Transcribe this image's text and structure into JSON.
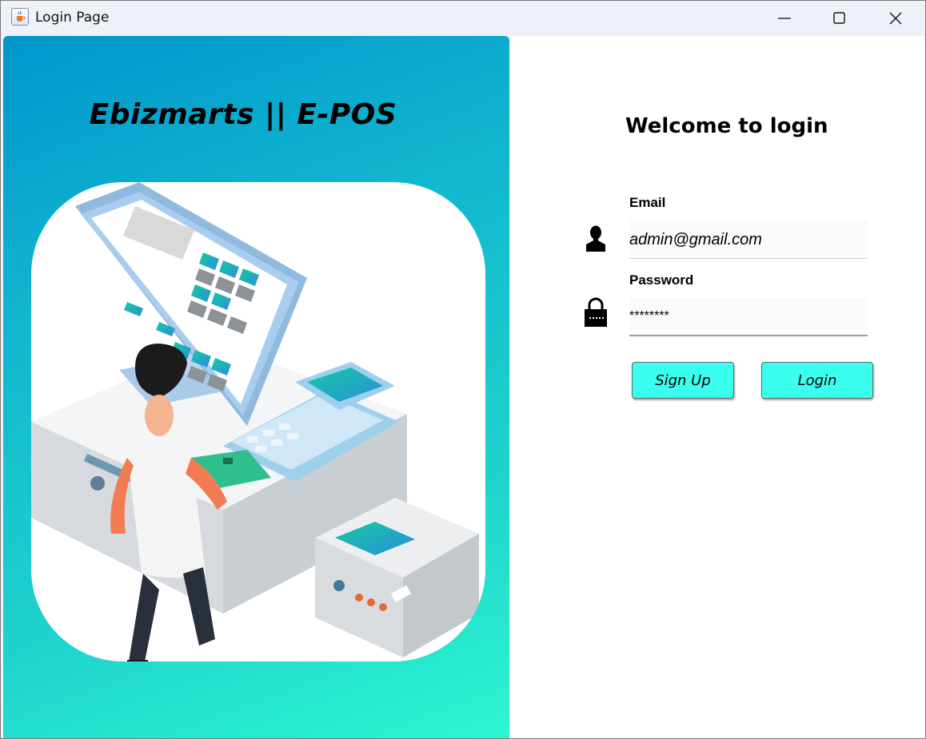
{
  "window": {
    "title": "Login Page",
    "icon": "java-cup-icon",
    "controls": [
      "minimize-icon",
      "maximize-icon",
      "close-icon"
    ]
  },
  "left": {
    "brand": "Ebizmarts || E-POS",
    "illustration": "pos-terminal-illustration",
    "gradient_from": "#0096cc",
    "gradient_to": "#2ef5d0"
  },
  "form": {
    "heading": "Welcome to login",
    "email_label": "Email",
    "email_value": "admin@gmail.com",
    "email_icon": "user-icon",
    "password_label": "Password",
    "password_value": "********",
    "password_icon": "lock-icon",
    "signup_label": "Sign Up",
    "login_label": "Login",
    "button_color": "#3bffee"
  }
}
